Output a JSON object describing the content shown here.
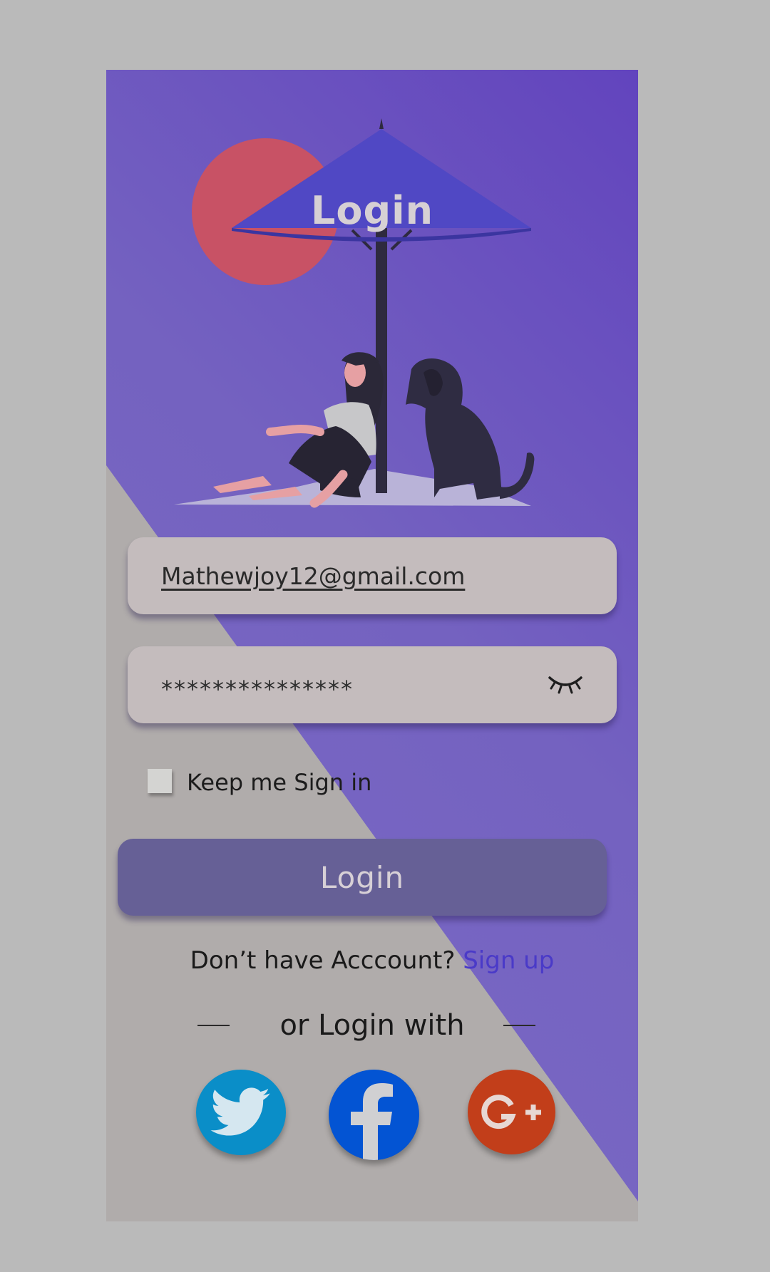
{
  "hero": {
    "title": "Login"
  },
  "form": {
    "email_value": "Mathewjoy12@gmail.com",
    "password_value": "***************",
    "keep_signed_in_label": "Keep me Sign in",
    "keep_signed_in_checked": false,
    "login_label": "Login"
  },
  "signup": {
    "prompt": "Don’t have Acccount?",
    "link": "Sign up"
  },
  "social": {
    "divider_text": "or Login with",
    "providers": [
      {
        "name": "twitter",
        "icon": "twitter-icon",
        "color": "#0a8ec8"
      },
      {
        "name": "facebook",
        "icon": "facebook-icon",
        "color": "#0354d3"
      },
      {
        "name": "google-plus",
        "icon": "google-plus-icon",
        "color": "#c23e1a"
      }
    ]
  },
  "colors": {
    "page_background": "#bababa",
    "card_background": "#b0acab",
    "accent_purple": "#6244be",
    "button": "#666096",
    "field": "#c4bcbd",
    "link": "#4a3ac8"
  }
}
